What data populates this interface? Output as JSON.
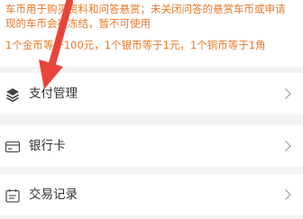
{
  "notice": {
    "line1": "车币用于购买资料和问答悬赏；未关闭问答的悬赏车币或申请",
    "line2": "现的车币会被冻结，暂不可使用",
    "line3": "1个金币等于100元，1个银币等于1元，1个铜币等于1角"
  },
  "menu": {
    "items": [
      {
        "label": "支付管理",
        "icon": "layers-icon"
      },
      {
        "label": "银行卡",
        "icon": "bank-card-icon"
      },
      {
        "label": "交易记录",
        "icon": "calendar-icon"
      }
    ]
  },
  "colors": {
    "notice_text": "#e8792b",
    "arrow": "#e8453a",
    "page_bg": "#f3f3f3"
  }
}
